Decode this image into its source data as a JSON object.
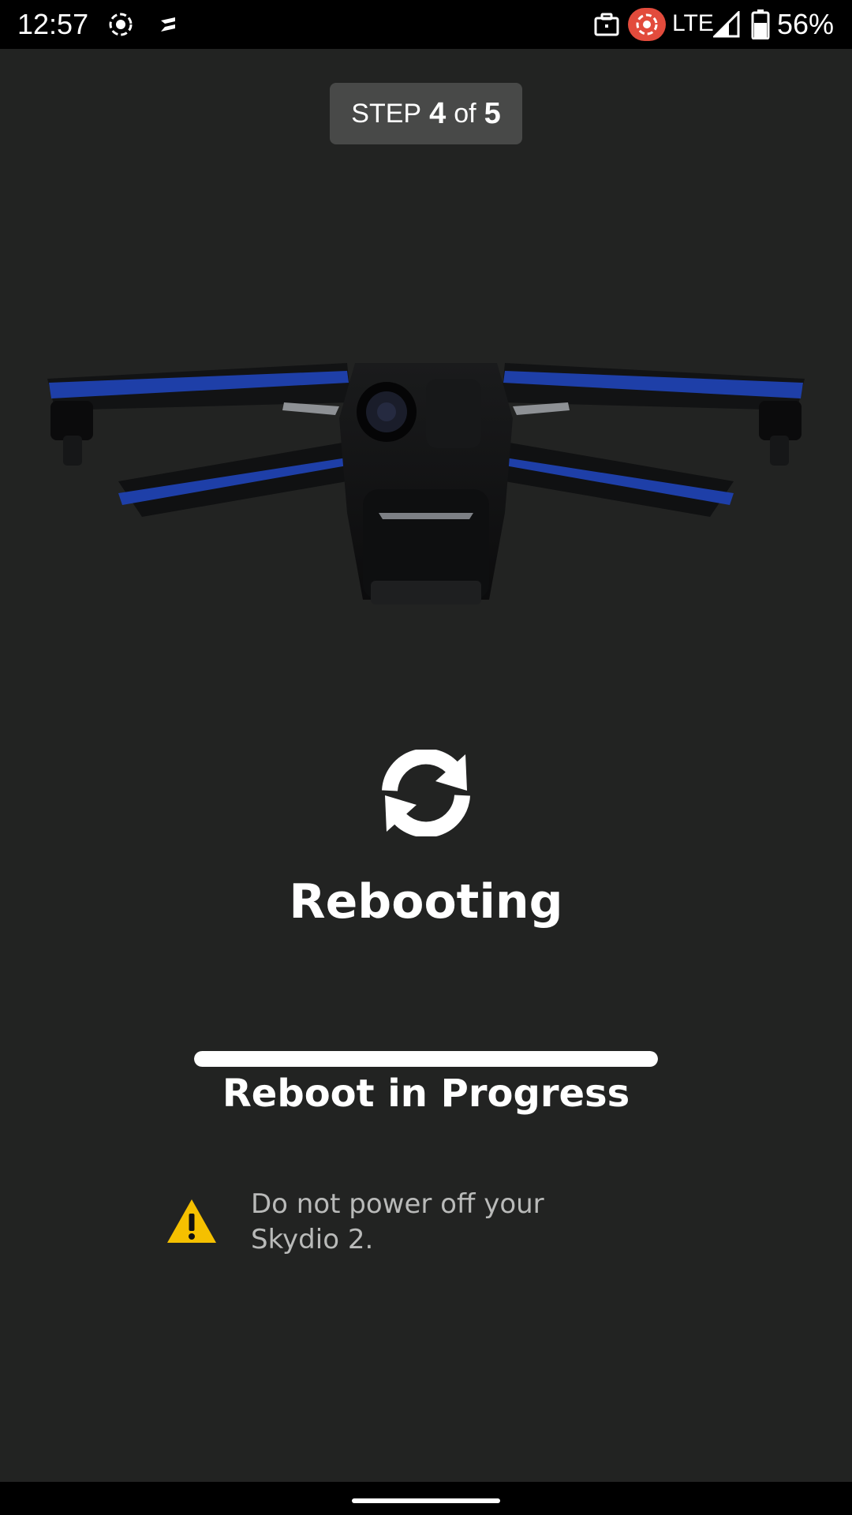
{
  "status_bar": {
    "time": "12:57",
    "network": "LTE",
    "battery": "56%",
    "icons": [
      "record-icon",
      "cast-icon",
      "work-profile-icon",
      "recording-alert-icon",
      "signal-icon",
      "battery-icon"
    ]
  },
  "step": {
    "prefix": "STEP",
    "current": "4",
    "separator": "of",
    "total": "5"
  },
  "illustration": "drone-image",
  "status": {
    "icon": "refresh-icon",
    "title": "Rebooting"
  },
  "progress": {
    "fraction": 1.0,
    "label": "Reboot in Progress"
  },
  "warning": {
    "icon": "warning-icon",
    "line1": "Do not power off your",
    "line2": "Skydio 2."
  },
  "colors": {
    "background": "#222322",
    "warning": "#F5C000",
    "drone_accent": "#1E3FA8",
    "recording_badge": "#E24B3C"
  }
}
